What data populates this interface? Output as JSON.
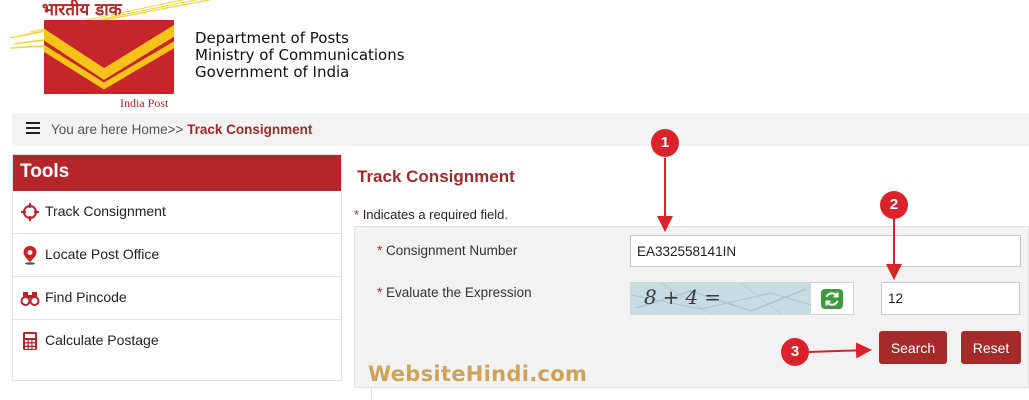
{
  "header": {
    "logo_hindi": "भारतीय डाक",
    "logo_english": "India Post",
    "dept_line1": "Department of Posts",
    "dept_line2": "Ministry of Communications",
    "dept_line3": "Government of India"
  },
  "breadcrumb": {
    "prefix": "You are here Home>>",
    "current": "Track Consignment"
  },
  "sidebar": {
    "title": "Tools",
    "items": [
      {
        "label": "Track Consignment",
        "icon": "crosshair-icon"
      },
      {
        "label": "Locate Post Office",
        "icon": "map-pin-icon"
      },
      {
        "label": "Find Pincode",
        "icon": "binoculars-icon"
      },
      {
        "label": "Calculate Postage",
        "icon": "calculator-icon"
      }
    ]
  },
  "main": {
    "title": "Track Consignment",
    "required_note": "Indicates a required field.",
    "required_mark": "*",
    "consignment_label": "Consignment Number",
    "consignment_value": "EA332558141IN",
    "expression_label": "Evaluate the Expression",
    "captcha_text": "8+4=",
    "expression_value": "12",
    "search_label": "Search",
    "reset_label": "Reset"
  },
  "annotations": {
    "marker1": "1",
    "marker2": "2",
    "marker3": "3",
    "watermark": "WebsiteHindi.com"
  },
  "colors": {
    "brand_red": "#b5262a",
    "button_red": "#a52a2a",
    "marker_red": "#d9222a",
    "logo_yellow": "#f7c21a"
  }
}
